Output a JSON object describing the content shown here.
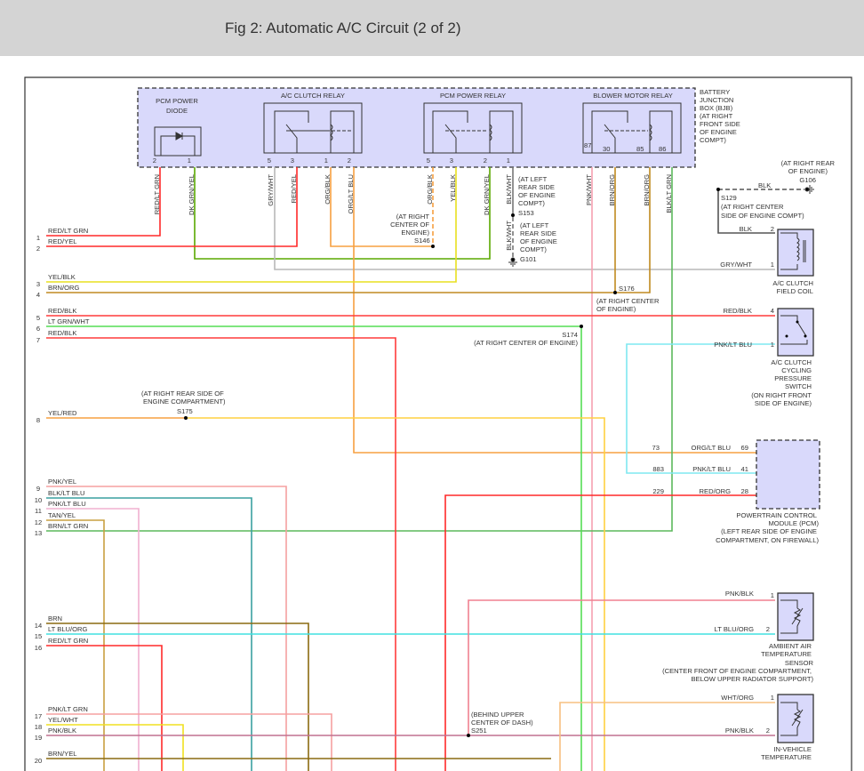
{
  "title": "Fig 2: Automatic A/C Circuit (2 of 2)",
  "junction_box": {
    "label": [
      "BATTERY",
      "JUNCTION",
      "BOX (BJB)",
      "(AT RIGHT",
      "FRONT SIDE",
      "OF ENGINE",
      "COMPT)"
    ],
    "fill_color": "#d9d9fb",
    "components": {
      "pcm_power_diode": {
        "name": [
          "PCM POWER",
          "DIODE"
        ],
        "pins": [
          "2",
          "1"
        ]
      },
      "ac_clutch_relay": {
        "name": "A/C CLUTCH RELAY",
        "pins": [
          "5",
          "3",
          "1",
          "2"
        ]
      },
      "pcm_power_relay": {
        "name": "PCM POWER RELAY",
        "pins": [
          "5",
          "3",
          "2",
          "1"
        ]
      },
      "blower_motor_relay": {
        "name": "BLOWER MOTOR RELAY",
        "pins": [
          "87",
          "30",
          "85",
          "86"
        ]
      }
    },
    "wire_labels": [
      "RED/LT GRN",
      "DK GRN/YEL",
      "GRY/WHT",
      "RED/YEL",
      "ORG/BLK",
      "ORG/LT BLU",
      "ORG/BLK",
      "YEL/BLK",
      "DK GRN/YEL",
      "BLK/WHT",
      "PNK/WHT",
      "BRN/ORG",
      "BRN/ORG",
      "BLK/LT GRN",
      "BLK/WHT"
    ]
  },
  "splices": {
    "s146": {
      "id": "S146",
      "location": [
        "(AT RIGHT",
        "CENTER OF",
        "ENGINE)"
      ]
    },
    "s153": {
      "id": "S153",
      "location": [
        "(AT LEFT",
        "REAR SIDE",
        "OF ENGINE",
        "COMPT)"
      ]
    },
    "g101": {
      "id": "G101",
      "location": [
        "(AT LEFT",
        "REAR SIDE",
        "OF ENGINE",
        "COMPT)"
      ]
    },
    "s176": {
      "id": "S176",
      "location": [
        "(AT RIGHT CENTER",
        "OF ENGINE)"
      ]
    },
    "s174": {
      "id": "S174",
      "location": [
        "(AT RIGHT CENTER OF ENGINE)"
      ]
    },
    "s175": {
      "id": "S175",
      "location": [
        "(AT RIGHT REAR SIDE OF",
        "ENGINE COMPARTMENT)"
      ]
    },
    "s251": {
      "id": "S251",
      "location": [
        "(BEHIND UPPER",
        "CENTER OF DASH)"
      ]
    },
    "s129": {
      "id": "S129",
      "location": [
        "(AT RIGHT CENTER",
        "SIDE OF ENGINE COMPT)"
      ]
    },
    "g106": {
      "id": "G106",
      "location": [
        "(AT RIGHT REAR",
        "OF ENGINE)"
      ],
      "wire": "BLK"
    }
  },
  "connector_rows": [
    {
      "num": "1",
      "wire": "RED/LT GRN"
    },
    {
      "num": "2",
      "wire": "RED/YEL"
    },
    {
      "num": "3",
      "wire": "YEL/BLK"
    },
    {
      "num": "4",
      "wire": "BRN/ORG"
    },
    {
      "num": "5",
      "wire": "RED/BLK"
    },
    {
      "num": "6",
      "wire": "LT GRN/WHT"
    },
    {
      "num": "7",
      "wire": "RED/BLK"
    },
    {
      "num": "8",
      "wire": "YEL/RED"
    },
    {
      "num": "9",
      "wire": "PNK/YEL"
    },
    {
      "num": "10",
      "wire": "BLK/LT BLU"
    },
    {
      "num": "11",
      "wire": "PNK/LT BLU"
    },
    {
      "num": "12",
      "wire": "TAN/YEL"
    },
    {
      "num": "13",
      "wire": "BRN/LT GRN"
    },
    {
      "num": "14",
      "wire": "BRN"
    },
    {
      "num": "15",
      "wire": "LT BLU/ORG"
    },
    {
      "num": "16",
      "wire": "RED/LT GRN"
    },
    {
      "num": "17",
      "wire": "PNK/LT GRN"
    },
    {
      "num": "18",
      "wire": "YEL/WHT"
    },
    {
      "num": "19",
      "wire": "PNK/BLK"
    },
    {
      "num": "20",
      "wire": "BRN/YEL"
    }
  ],
  "ac_clutch_field_coil": {
    "name": [
      "A/C CLUTCH",
      "FIELD COIL"
    ],
    "pins": [
      {
        "pin": "2",
        "wire": "BLK"
      },
      {
        "pin": "1",
        "wire": "GRY/WHT"
      }
    ]
  },
  "ac_cycling_switch": {
    "name": [
      "A/C CLUTCH",
      "CYCLING",
      "PRESSURE",
      "SWITCH",
      "(ON RIGHT FRONT",
      "SIDE OF ENGINE)"
    ],
    "pins": [
      {
        "pin": "4",
        "wire": "RED/BLK"
      },
      {
        "pin": "1",
        "wire": "PNK/LT BLU"
      }
    ]
  },
  "pcm": {
    "name": [
      "POWERTRAIN CONTROL",
      "MODULE (PCM)",
      "(LEFT REAR SIDE OF ENGINE",
      "COMPARTMENT, ON FIREWALL)"
    ],
    "pins": [
      {
        "circuit": "73",
        "wire": "ORG/LT BLU",
        "pin": "69"
      },
      {
        "circuit": "883",
        "wire": "PNK/LT BLU",
        "pin": "41"
      },
      {
        "circuit": "229",
        "wire": "RED/ORG",
        "pin": "28"
      }
    ]
  },
  "ambient_sensor": {
    "name": [
      "AMBIENT AIR",
      "TEMPERATURE",
      "SENSOR",
      "(CENTER FRONT OF ENGINE COMPARTMENT,",
      "BELOW UPPER RADIATOR SUPPORT)"
    ],
    "pins": [
      {
        "pin": "1",
        "wire": "PNK/BLK"
      },
      {
        "pin": "2",
        "wire": "LT BLU/ORG"
      }
    ]
  },
  "in_vehicle_sensor": {
    "name": [
      "IN-VEHICLE",
      "TEMPERATURE"
    ],
    "pins": [
      {
        "pin": "1",
        "wire": "WHT/ORG"
      },
      {
        "pin": "2",
        "wire": "PNK/BLK"
      }
    ]
  }
}
